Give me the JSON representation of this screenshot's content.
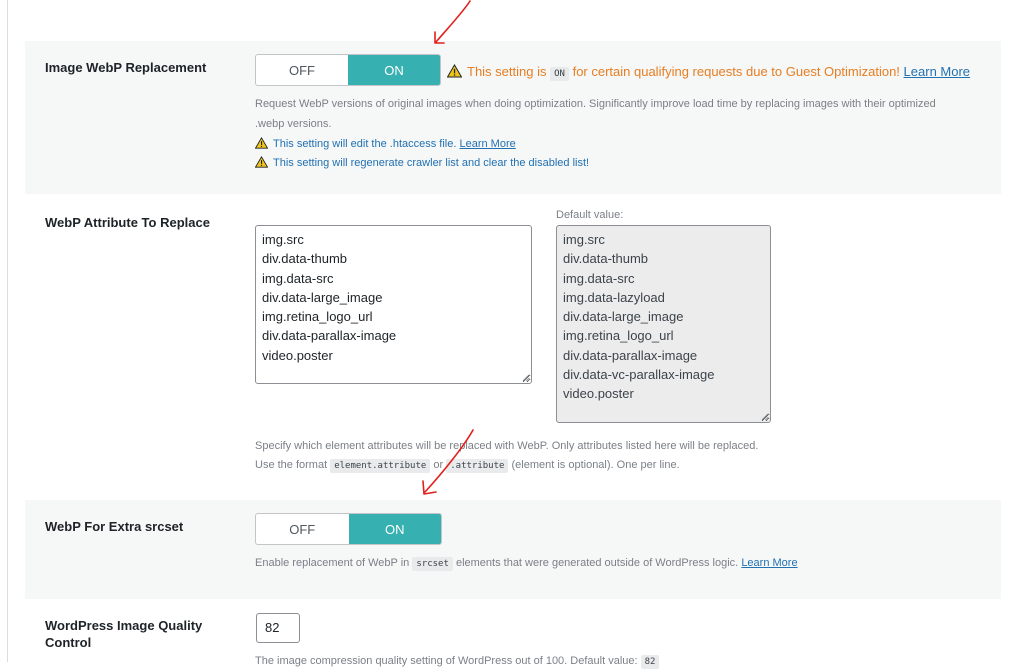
{
  "webp_replacement": {
    "label": "Image WebP Replacement",
    "toggle": {
      "off": "OFF",
      "on": "ON",
      "state": "on"
    },
    "warning": {
      "prefix": "This setting is",
      "badge": "ON",
      "suffix": "for certain qualifying requests due to Guest Optimization!",
      "link": "Learn More"
    },
    "description_line1": "Request WebP versions of original images when doing optimization. Significantly improve load time by replacing images with their optimized",
    "description_line2": ".webp versions.",
    "notice_htaccess": "This setting will edit the .htaccess file.",
    "notice_htaccess_link": "Learn More",
    "notice_crawler": "This setting will regenerate crawler list and clear the disabled list!"
  },
  "webp_attribute": {
    "label": "WebP Attribute To Replace",
    "value": "img.src\ndiv.data-thumb\nimg.data-src\ndiv.data-large_image\nimg.retina_logo_url\ndiv.data-parallax-image\nvideo.poster",
    "default_label": "Default value:",
    "default_value": "img.src\ndiv.data-thumb\nimg.data-src\nimg.data-lazyload\ndiv.data-large_image\nimg.retina_logo_url\ndiv.data-parallax-image\ndiv.data-vc-parallax-image\nvideo.poster",
    "help_line1": "Specify which element attributes will be replaced with WebP. Only attributes listed here will be replaced.",
    "help_format_prefix": "Use the format",
    "help_format_code1": "element.attribute",
    "help_format_or": "or",
    "help_format_code2": ".attribute",
    "help_format_suffix": "(element is optional). One per line."
  },
  "webp_srcset": {
    "label": "WebP For Extra srcset",
    "toggle": {
      "off": "OFF",
      "on": "ON",
      "state": "on"
    },
    "help_prefix": "Enable replacement of WebP in",
    "help_code": "srcset",
    "help_suffix": "elements that were generated outside of WordPress logic.",
    "help_link": "Learn More"
  },
  "image_quality": {
    "label_line1": "WordPress Image Quality",
    "label_line2": "Control",
    "value": "82",
    "help_prefix": "The image compression quality setting of WordPress out of 100. Default value:",
    "help_code": "82"
  },
  "colors": {
    "toggle_on": "#36b0b0",
    "warning": "#e67e22",
    "link": "#2271b1",
    "annotation_arrow": "#e0201b"
  },
  "icons": [
    "warning-icon",
    "annotation-arrow"
  ]
}
